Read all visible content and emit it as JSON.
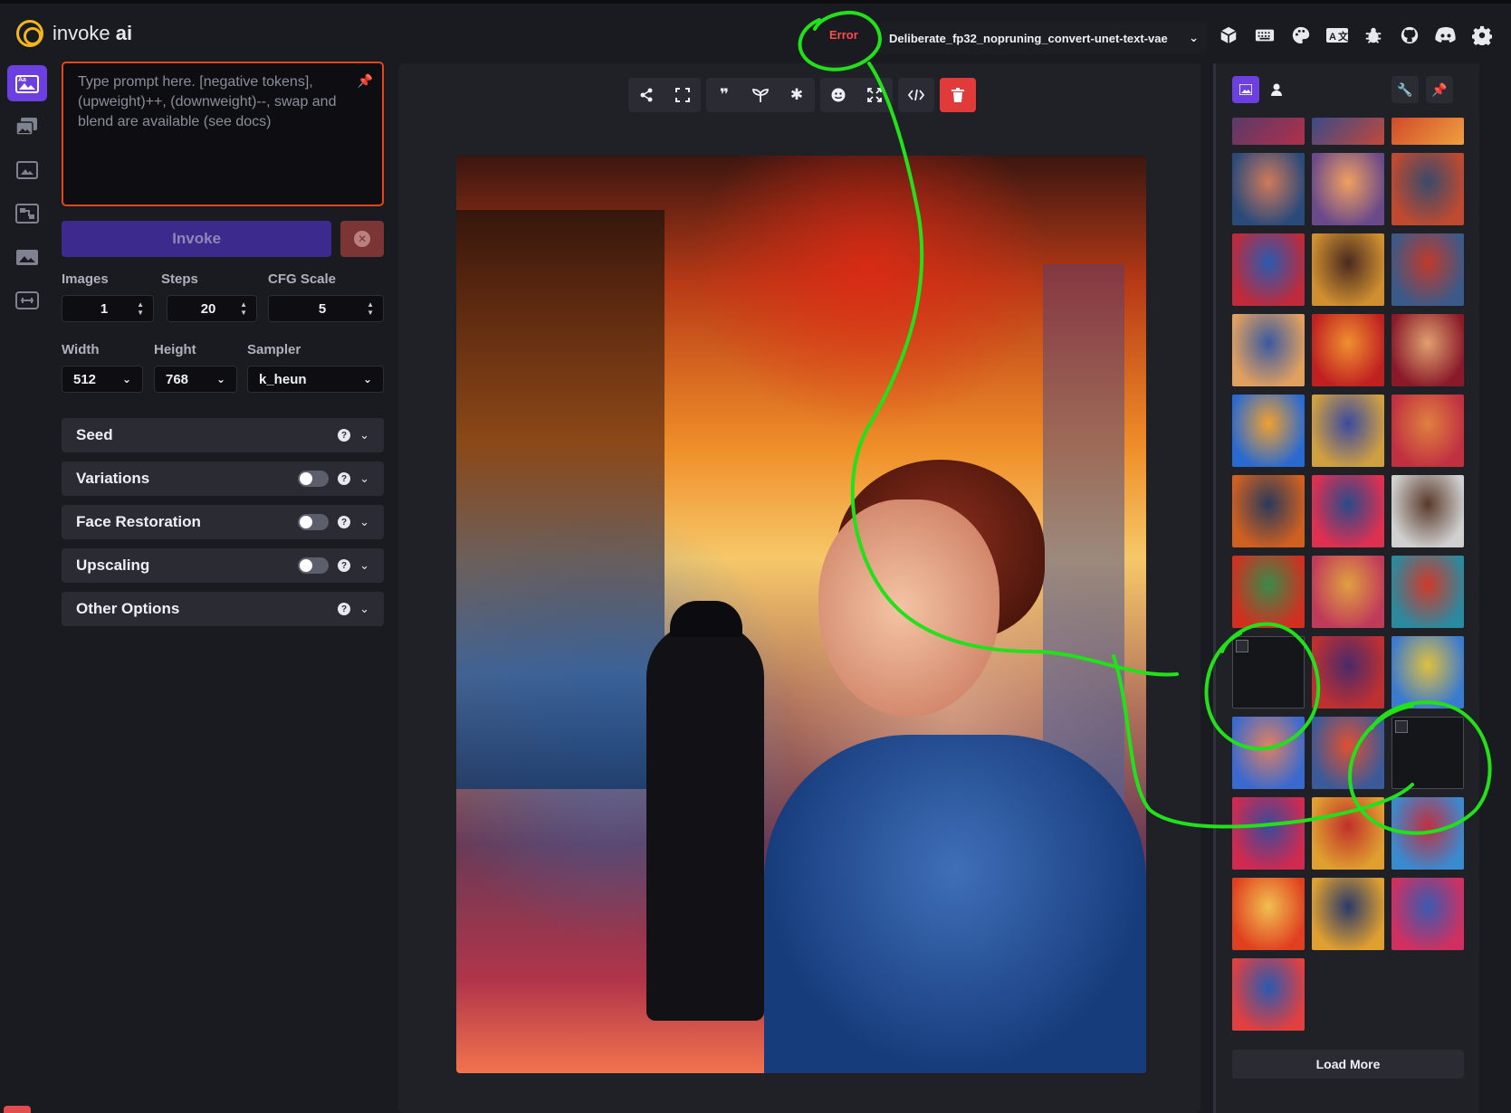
{
  "app": {
    "logo_text": "invoke",
    "logo_bold": "ai"
  },
  "header": {
    "status": "Error",
    "model": "Deliberate_fp32_nopruning_convert-unet-text-vae",
    "icons": [
      "cube-icon",
      "keyboard-icon",
      "palette-icon",
      "translate-icon",
      "bug-icon",
      "github-icon",
      "discord-icon",
      "settings-icon"
    ]
  },
  "rail": {
    "items": [
      "text-to-image-icon",
      "image-to-image-icon",
      "unified-canvas-icon",
      "nodes-icon",
      "postprocessing-icon",
      "training-icon"
    ]
  },
  "prompt": {
    "placeholder": "Type prompt here. [negative tokens], (upweight)++, (downweight)--, swap and blend are available (see docs)"
  },
  "invoke": {
    "label": "Invoke"
  },
  "params": {
    "images": {
      "label": "Images",
      "value": "1"
    },
    "steps": {
      "label": "Steps",
      "value": "20"
    },
    "cfg": {
      "label": "CFG Scale",
      "value": "5"
    },
    "width": {
      "label": "Width",
      "value": "512"
    },
    "height": {
      "label": "Height",
      "value": "768"
    },
    "sampler": {
      "label": "Sampler",
      "value": "k_heun"
    }
  },
  "accordions": [
    {
      "title": "Seed",
      "toggle": false
    },
    {
      "title": "Variations",
      "toggle": true
    },
    {
      "title": "Face Restoration",
      "toggle": true
    },
    {
      "title": "Upscaling",
      "toggle": true
    },
    {
      "title": "Other Options",
      "toggle": false
    }
  ],
  "toolbar": {
    "icons": [
      "share-icon",
      "fullscreen-icon",
      "quote-icon",
      "sprout-icon",
      "asterisk-icon",
      "face-icon",
      "expand-icon",
      "code-icon",
      "trash-icon"
    ]
  },
  "gallery": {
    "load_more": "Load More",
    "thumb_colors": [
      [
        "#5a3a6a",
        "#b0304a"
      ],
      [
        "#3a4a8a",
        "#c04a3a"
      ],
      [
        "#d04a2a",
        "#f0a040"
      ],
      [
        "#2a4a7a",
        "#d07a5a"
      ],
      [
        "#6a4a8a",
        "#f0a060"
      ],
      [
        "#c04a30",
        "#3a4a6a"
      ],
      [
        "#c02a3a",
        "#2a5ab0"
      ],
      [
        "#d09030",
        "#4a2a20"
      ],
      [
        "#3a5a8a",
        "#c03a2a"
      ],
      [
        "#e0a060",
        "#3a5aa0"
      ],
      [
        "#c02020",
        "#f09030"
      ],
      [
        "#8a1a2a",
        "#e0a070"
      ],
      [
        "#2a6ad0",
        "#f0a030"
      ],
      [
        "#d0a040",
        "#3a4aa0"
      ],
      [
        "#c03040",
        "#e08040"
      ],
      [
        "#d06020",
        "#2a3a5a"
      ],
      [
        "#e03050",
        "#2a4a8a"
      ],
      [
        "#d0d0d0",
        "#5a3a2a"
      ],
      [
        "#d03020",
        "#3a8a4a"
      ],
      [
        "#c03a5a",
        "#e0a040"
      ],
      [
        "#2a8aa0",
        "#d03a2a"
      ],
      [
        "broken"
      ],
      [
        "#c03030",
        "#4a2a6a"
      ],
      [
        "#3a7ad0",
        "#e0c040"
      ],
      [
        "#3a6ad0",
        "#e08060"
      ],
      [
        "#3a5a9a",
        "#e05030"
      ],
      [
        "broken"
      ],
      [
        "#d02a50",
        "#3a4a9a"
      ],
      [
        "#e0a030",
        "#c0302a"
      ],
      [
        "#3a8ad0",
        "#c03040"
      ],
      [
        "#e04020",
        "#f0c050"
      ],
      [
        "#e0a030",
        "#2a3a6a"
      ],
      [
        "#d03060",
        "#3a5ab0"
      ],
      [
        "#e04040",
        "#2a5ab0"
      ]
    ]
  }
}
